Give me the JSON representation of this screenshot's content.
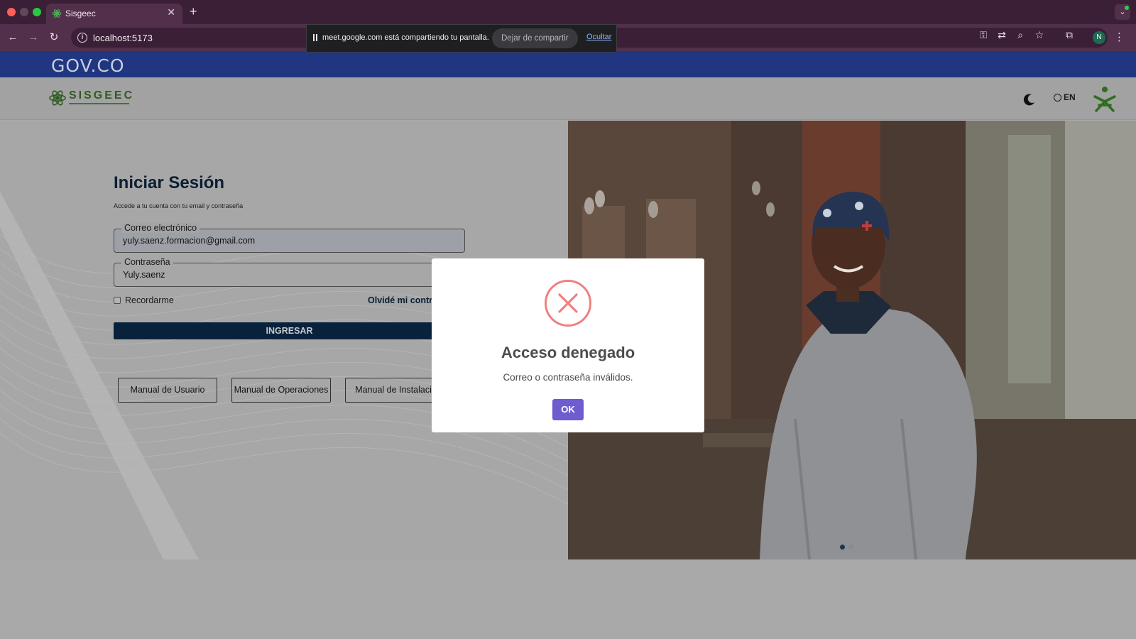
{
  "browser": {
    "tab_title": "Sisgeec",
    "url": "localhost:5173",
    "profile_initial": "N",
    "share_banner": {
      "message": "meet.google.com está compartiendo tu pantalla.",
      "stop_label": "Dejar de compartir",
      "hide_label": "Ocultar"
    }
  },
  "gov_bar": {
    "logo_text": "GOV.CO"
  },
  "header": {
    "brand_name": "SISGEEC",
    "language_label": "EN"
  },
  "login": {
    "title": "Iniciar Sesión",
    "subtitle": "Accede a tu cuenta con tu email y contraseña",
    "email": {
      "label": "Correo electrónico",
      "value": "yuly.saenz.formacion@gmail.com"
    },
    "password": {
      "label": "Contraseña",
      "value": "Yuly.saenz"
    },
    "remember_label": "Recordarme",
    "forgot_label": "Olvidé mi contraseña",
    "submit_label": "INGRESAR",
    "manuals": [
      "Manual de Usuario",
      "Manual de Operaciones",
      "Manual de Instalación"
    ]
  },
  "modal": {
    "title": "Acceso denegado",
    "message": "Correo o contraseña inválidos.",
    "ok_label": "OK"
  },
  "colors": {
    "gov_blue": "#203680",
    "primary_dark": "#08223c",
    "error_red": "#f0807f",
    "confirm_purple": "#6d5dcf",
    "sena_green": "#39a900"
  }
}
